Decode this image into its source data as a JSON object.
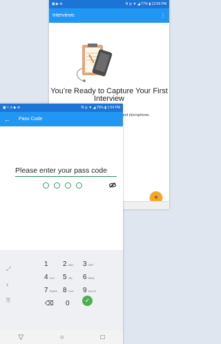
{
  "bg_screen": {
    "status": {
      "left_icons": "▣ ▶ ⊜",
      "right_text": "N ◎ ▼ ◢ 77% ▮ 12:59 PM"
    },
    "appbar": {
      "title": "Interviews",
      "menu_icon": "⋮"
    },
    "headline": "You’re Ready to Capture Your First Interview",
    "subtext": "and microphone.",
    "fab_label": "+"
  },
  "fg_screen": {
    "status": {
      "left_icons": "▣ ≈ ⊙ ▶ ⊜",
      "right_text": "N ◎ ▼ ◢ 75% ▮ 1:04 PM"
    },
    "appbar": {
      "back_icon": "←",
      "title": "Pass Code"
    },
    "prompt": "Please enter your pass code",
    "keypad": {
      "rows": [
        [
          {
            "num": "1",
            "letters": ""
          },
          {
            "num": "2",
            "letters": "ABC"
          },
          {
            "num": "3",
            "letters": "DEF"
          }
        ],
        [
          {
            "num": "4",
            "letters": "GHI"
          },
          {
            "num": "5",
            "letters": "JKL"
          },
          {
            "num": "6",
            "letters": "MNO"
          }
        ],
        [
          {
            "num": "7",
            "letters": "PQRS"
          },
          {
            "num": "8",
            "letters": "TUV"
          },
          {
            "num": "9",
            "letters": "WXYZ"
          }
        ]
      ],
      "zero": "0",
      "backspace": "⌫",
      "ok": "✓"
    },
    "nav": {
      "back": "▽",
      "home": "○",
      "recent": "□"
    }
  },
  "colors": {
    "primary": "#2196f3",
    "status": "#1c74d6",
    "accent": "#f5a623",
    "pin": "#3a9a5f",
    "ok": "#4caf50"
  }
}
